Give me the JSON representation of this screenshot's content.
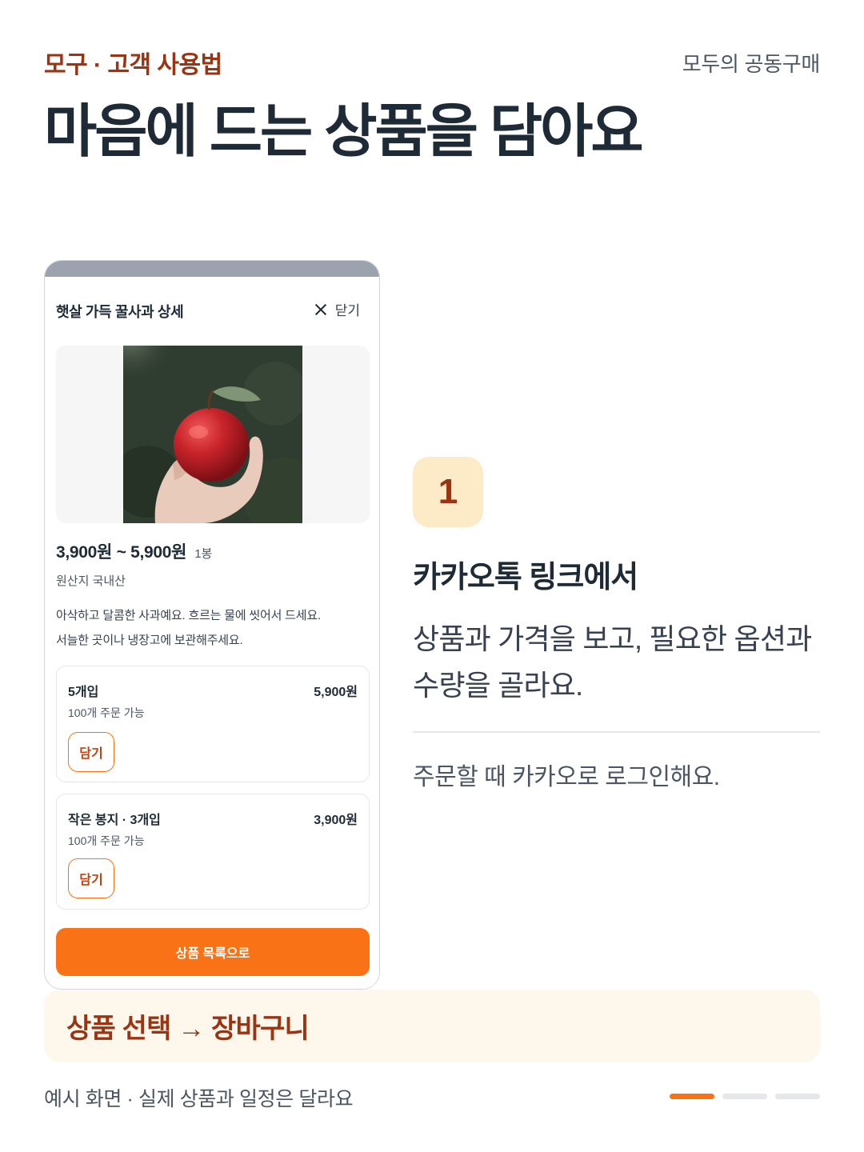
{
  "header": {
    "eyebrow": "모구 · 고객 사용법",
    "brand": "모두의 공동구매",
    "headline": "마음에 드는 상품을 담아요"
  },
  "phone": {
    "sheet_title": "햇살 가득 꿀사과 상세",
    "close_label": "닫기",
    "price": "3,900원 ~ 5,900원",
    "unit": "1봉",
    "origin": "원산지 국내산",
    "description_lines": [
      "아삭하고 달콤한 사과예요. 흐르는 물에 씻어서 드세요.",
      "서늘한 곳이나 냉장고에 보관해주세요."
    ],
    "options": [
      {
        "name": "5개입",
        "price": "5,900원",
        "stock": "100개 주문 가능",
        "add_label": "담기"
      },
      {
        "name": "작은 봉지 · 3개입",
        "price": "3,900원",
        "stock": "100개 주문 가능",
        "add_label": "담기"
      }
    ],
    "primary_button": "상품 목록으로"
  },
  "step": {
    "number": "1",
    "title": "카카오톡 링크에서",
    "body_lines": [
      "상품과 가격을 보고, 필요한 옵션과",
      "수량을 골라요."
    ],
    "note": "주문할 때 카카오로 로그인해요."
  },
  "flow": {
    "text": "상품 선택 → 장바구니"
  },
  "footer": {
    "note": "예시 화면 · 실제 상품과 일정은 달라요",
    "pager": {
      "total": 3,
      "current": 1
    }
  },
  "colors": {
    "accent": "#f97316",
    "accent_dark": "#9a3412",
    "badge_bg": "#fdebc8",
    "banner_bg": "#fef7ec",
    "text": "#1f2a37"
  }
}
